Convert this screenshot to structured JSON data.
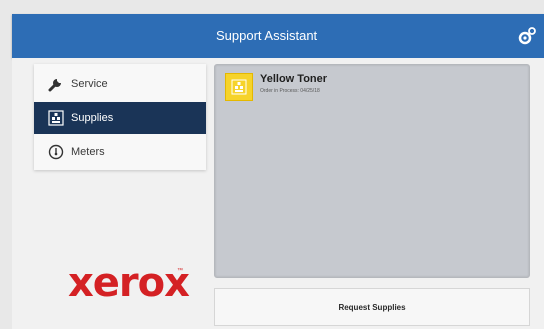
{
  "header": {
    "title": "Support Assistant"
  },
  "nav": {
    "items": [
      {
        "label": "Service",
        "icon": "wrench-icon",
        "active": false
      },
      {
        "label": "Supplies",
        "icon": "supplies-icon",
        "active": true
      },
      {
        "label": "Meters",
        "icon": "meter-icon",
        "active": false
      }
    ]
  },
  "brand": {
    "logo_text": "xerox",
    "trademark": "™",
    "color": "#d42124"
  },
  "supplies": {
    "item_title": "Yellow Toner",
    "item_status": "Order in Process: 04/25/18",
    "item_color": "#f6d32a"
  },
  "actions": {
    "request_label": "Request Supplies"
  },
  "colors": {
    "header": "#2d6db5",
    "active_nav": "#1a3457"
  }
}
